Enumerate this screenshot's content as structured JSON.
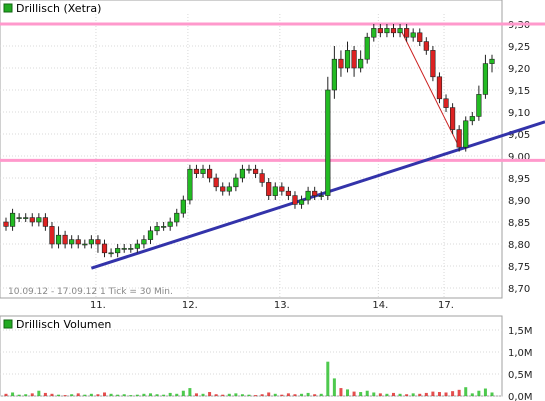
{
  "price_panel": {
    "title": "Drillisch (Xetra)",
    "info": "10.09.12 - 17.09.12   1 Tick = 30 Min.",
    "legend_color": "#22aa22"
  },
  "volume_panel": {
    "title": "Drillisch Volumen",
    "legend_color": "#22aa22"
  },
  "colors": {
    "up": "#22bb22",
    "down": "#dd2222",
    "trendline": "#3333aa",
    "resistance": "#ff99cc",
    "minor_trend": "#cc2222"
  },
  "chart_data": [
    {
      "type": "candlestick",
      "title": "Drillisch (Xetra)",
      "x_ticks": [
        "11.",
        "12.",
        "13.",
        "14.",
        "17."
      ],
      "y_ticks": [
        "8,70",
        "8,75",
        "8,80",
        "8,85",
        "8,90",
        "8,95",
        "9,00",
        "9,05",
        "9,10",
        "9,15",
        "9,20",
        "9,25",
        "9,30"
      ],
      "ylim": [
        8.7,
        9.3
      ],
      "grid": true,
      "candles": [
        [
          8.85,
          8.84,
          8.86,
          8.83
        ],
        [
          8.84,
          8.87,
          8.88,
          8.83
        ],
        [
          8.86,
          8.86,
          8.87,
          8.85
        ],
        [
          8.86,
          8.86,
          8.87,
          8.85
        ],
        [
          8.86,
          8.85,
          8.87,
          8.84
        ],
        [
          8.85,
          8.86,
          8.87,
          8.84
        ],
        [
          8.86,
          8.84,
          8.87,
          8.83
        ],
        [
          8.84,
          8.8,
          8.85,
          8.79
        ],
        [
          8.8,
          8.82,
          8.84,
          8.79
        ],
        [
          8.82,
          8.8,
          8.83,
          8.79
        ],
        [
          8.8,
          8.81,
          8.82,
          8.79
        ],
        [
          8.81,
          8.8,
          8.82,
          8.79
        ],
        [
          8.8,
          8.8,
          8.81,
          8.79
        ],
        [
          8.8,
          8.81,
          8.82,
          8.79
        ],
        [
          8.81,
          8.8,
          8.82,
          8.78
        ],
        [
          8.8,
          8.78,
          8.81,
          8.77
        ],
        [
          8.78,
          8.78,
          8.79,
          8.77
        ],
        [
          8.78,
          8.79,
          8.8,
          8.77
        ],
        [
          8.79,
          8.79,
          8.8,
          8.78
        ],
        [
          8.79,
          8.79,
          8.8,
          8.78
        ],
        [
          8.79,
          8.8,
          8.81,
          8.78
        ],
        [
          8.8,
          8.81,
          8.82,
          8.79
        ],
        [
          8.81,
          8.83,
          8.84,
          8.8
        ],
        [
          8.83,
          8.84,
          8.85,
          8.82
        ],
        [
          8.84,
          8.84,
          8.85,
          8.83
        ],
        [
          8.84,
          8.85,
          8.86,
          8.83
        ],
        [
          8.85,
          8.87,
          8.88,
          8.84
        ],
        [
          8.87,
          8.9,
          8.91,
          8.86
        ],
        [
          8.9,
          8.97,
          8.98,
          8.89
        ],
        [
          8.97,
          8.96,
          8.98,
          8.95
        ],
        [
          8.96,
          8.97,
          8.98,
          8.95
        ],
        [
          8.97,
          8.95,
          8.98,
          8.94
        ],
        [
          8.95,
          8.93,
          8.96,
          8.92
        ],
        [
          8.93,
          8.92,
          8.94,
          8.91
        ],
        [
          8.92,
          8.93,
          8.94,
          8.91
        ],
        [
          8.93,
          8.95,
          8.96,
          8.92
        ],
        [
          8.95,
          8.97,
          8.98,
          8.94
        ],
        [
          8.97,
          8.97,
          8.98,
          8.96
        ],
        [
          8.97,
          8.96,
          8.98,
          8.95
        ],
        [
          8.96,
          8.94,
          8.97,
          8.93
        ],
        [
          8.94,
          8.91,
          8.95,
          8.9
        ],
        [
          8.91,
          8.93,
          8.94,
          8.9
        ],
        [
          8.93,
          8.92,
          8.94,
          8.91
        ],
        [
          8.92,
          8.91,
          8.93,
          8.9
        ],
        [
          8.91,
          8.89,
          8.92,
          8.88
        ],
        [
          8.89,
          8.9,
          8.91,
          8.88
        ],
        [
          8.9,
          8.92,
          8.93,
          8.89
        ],
        [
          8.92,
          8.91,
          8.93,
          8.9
        ],
        [
          8.91,
          8.91,
          8.92,
          8.9
        ],
        [
          8.91,
          9.15,
          9.18,
          8.9
        ],
        [
          9.15,
          9.22,
          9.25,
          9.13
        ],
        [
          9.22,
          9.2,
          9.24,
          9.18
        ],
        [
          9.2,
          9.24,
          9.26,
          9.19
        ],
        [
          9.24,
          9.2,
          9.25,
          9.18
        ],
        [
          9.2,
          9.22,
          9.24,
          9.19
        ],
        [
          9.22,
          9.27,
          9.28,
          9.21
        ],
        [
          9.27,
          9.29,
          9.3,
          9.26
        ],
        [
          9.29,
          9.28,
          9.3,
          9.27
        ],
        [
          9.28,
          9.29,
          9.3,
          9.27
        ],
        [
          9.29,
          9.28,
          9.3,
          9.27
        ],
        [
          9.28,
          9.29,
          9.3,
          9.27
        ],
        [
          9.29,
          9.27,
          9.3,
          9.26
        ],
        [
          9.27,
          9.28,
          9.29,
          9.26
        ],
        [
          9.28,
          9.26,
          9.29,
          9.25
        ],
        [
          9.26,
          9.24,
          9.27,
          9.23
        ],
        [
          9.24,
          9.18,
          9.25,
          9.17
        ],
        [
          9.18,
          9.13,
          9.19,
          9.12
        ],
        [
          9.13,
          9.11,
          9.14,
          9.1
        ],
        [
          9.11,
          9.06,
          9.12,
          9.05
        ],
        [
          9.06,
          9.02,
          9.07,
          9.01
        ],
        [
          9.02,
          9.08,
          9.09,
          9.01
        ],
        [
          9.08,
          9.09,
          9.1,
          9.07
        ],
        [
          9.09,
          9.14,
          9.16,
          9.08
        ],
        [
          9.14,
          9.21,
          9.23,
          9.13
        ],
        [
          9.21,
          9.22,
          9.23,
          9.19
        ]
      ],
      "trendline": [
        [
          8.745,
          9.055
        ]
      ],
      "resistance_levels": [
        9.3,
        8.99
      ],
      "minor_trend": [
        9.29,
        9.02
      ]
    },
    {
      "type": "bar",
      "title": "Drillisch Volumen",
      "y_ticks": [
        "0,0M",
        "0,5M",
        "1,0M",
        "1,5M"
      ],
      "ylim": [
        0,
        1.5
      ],
      "values": [
        0.05,
        0.08,
        0.03,
        0.04,
        0.06,
        0.12,
        0.07,
        0.05,
        0.03,
        0.02,
        0.04,
        0.06,
        0.03,
        0.05,
        0.04,
        0.08,
        0.05,
        0.03,
        0.04,
        0.02,
        0.03,
        0.05,
        0.06,
        0.04,
        0.03,
        0.07,
        0.05,
        0.12,
        0.18,
        0.06,
        0.05,
        0.09,
        0.04,
        0.03,
        0.05,
        0.06,
        0.04,
        0.03,
        0.02,
        0.04,
        0.08,
        0.05,
        0.03,
        0.06,
        0.04,
        0.05,
        0.07,
        0.04,
        0.05,
        0.78,
        0.4,
        0.18,
        0.15,
        0.1,
        0.09,
        0.12,
        0.08,
        0.06,
        0.05,
        0.07,
        0.05,
        0.04,
        0.06,
        0.05,
        0.07,
        0.1,
        0.09,
        0.08,
        0.11,
        0.14,
        0.2,
        0.06,
        0.12,
        0.17,
        0.08
      ]
    }
  ]
}
